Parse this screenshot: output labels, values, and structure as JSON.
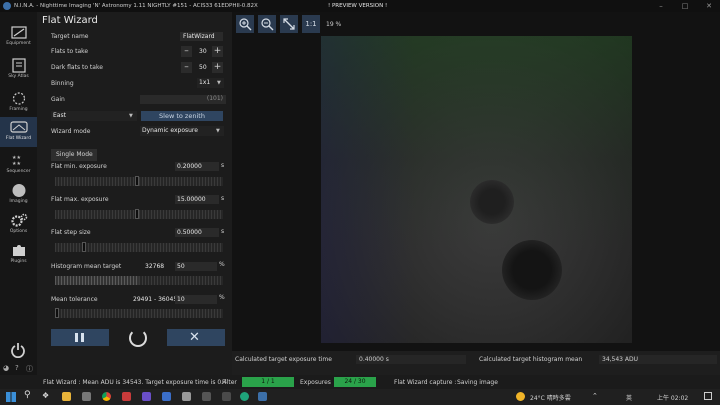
{
  "titlebar": {
    "app_title": "N.I.N.A. - Nighttime Imaging 'N' Astronomy 1.11 NIGHTLY #151 - ACIS33 61EDPHII-0.82X",
    "preview_banner": "! PREVIEW VERSION !"
  },
  "sidebar": {
    "items": [
      {
        "label": "Equipment",
        "icon": "camera-icon"
      },
      {
        "label": "Sky Atlas",
        "icon": "atlas-icon"
      },
      {
        "label": "Framing",
        "icon": "framing-icon"
      },
      {
        "label": "Flat Wizard",
        "icon": "flat-wizard-icon"
      },
      {
        "label": "Sequencer",
        "icon": "stars-icon"
      },
      {
        "label": "Imaging",
        "icon": "imaging-icon"
      },
      {
        "label": "Options",
        "icon": "gears-icon"
      },
      {
        "label": "Plugins",
        "icon": "puzzle-icon"
      }
    ],
    "active": "Flat Wizard"
  },
  "panel": {
    "title": "Flat Wizard",
    "target_name_label": "Target name",
    "target_name_value": "FlatWizard",
    "flats_label": "Flats to take",
    "flats_value": "30",
    "darkflats_label": "Dark flats to take",
    "darkflats_value": "50",
    "binning_label": "Binning",
    "binning_value": "1x1",
    "gain_label": "Gain",
    "gain_value": "(101)",
    "pier_side": "East",
    "slew_label": "Slew to zenith",
    "wizard_mode_label": "Wizard mode",
    "wizard_mode_value": "Dynamic exposure",
    "single_mode_tab": "Single Mode",
    "flat_min_label": "Flat min. exposure",
    "flat_min_value": "0.20000",
    "flat_max_label": "Flat max. exposure",
    "flat_max_value": "15.00000",
    "step_label": "Flat step size",
    "step_value": "0.50000",
    "unit_s": "s",
    "hist_label": "Histogram mean target",
    "hist_adu": "32768",
    "hist_value": "50",
    "unit_pct": "%",
    "tol_label": "Mean tolerance",
    "tol_range": "29491 - 36045",
    "tol_value": "10"
  },
  "toolbar": {
    "one_to_one": "1:1",
    "zoom_label": "19 %"
  },
  "calc": {
    "exposure_label": "Calculated target exposure time",
    "exposure_value": "0.40000 s",
    "hist_label": "Calculated target histogram mean",
    "hist_value": "34,543 ADU"
  },
  "status": {
    "message": "Flat Wizard :   Mean ADU is 34543. Target exposure time is 0.4",
    "filter_label": "Filter",
    "filter_value": "1 / 1",
    "exposures_label": "Exposures",
    "exposures_value": "24 / 30",
    "capture_label": "Flat Wizard capture :",
    "capture_value": "Saving image"
  },
  "taskbar": {
    "weather": "24°C 晴時多雲",
    "ime": "英",
    "time": "上午 02:02"
  },
  "colors": {
    "accent": "#2f4560",
    "progress_green": "#2aa24a"
  }
}
